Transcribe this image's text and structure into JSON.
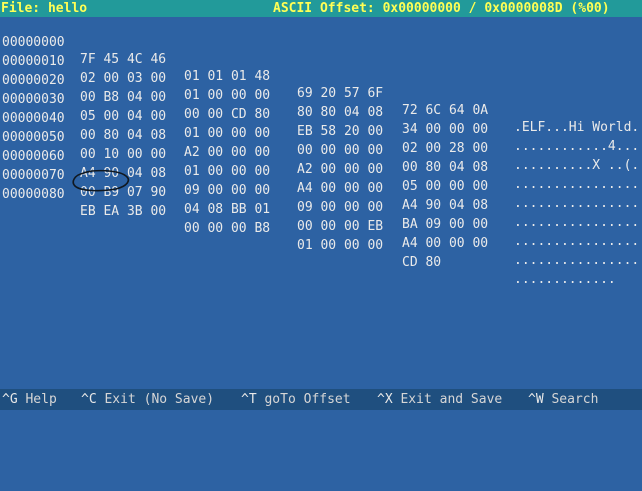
{
  "header": {
    "file_label": "File: hello",
    "offset_label": "ASCII Offset: 0x00000000 / 0x0000008D (%00)"
  },
  "rows": [
    {
      "addr": "00000000",
      "g1": "7F 45 4C 46",
      "g2": "01 01 01 48",
      "g3": "69 20 57 6F",
      "g4": "72 6C 64 0A",
      "ascii": ".ELF...Hi World."
    },
    {
      "addr": "00000010",
      "g1": "02 00 03 00",
      "g2": "01 00 00 00",
      "g3": "80 80 04 08",
      "g4": "34 00 00 00",
      "ascii": "............4..."
    },
    {
      "addr": "00000020",
      "g1": "00 B8 04 00",
      "g2": "00 00 CD 80",
      "g3": "EB 58 20 00",
      "g4": "02 00 28 00",
      "ascii": "..........X ..(."
    },
    {
      "addr": "00000030",
      "g1": "05 00 04 00",
      "g2": "01 00 00 00",
      "g3": "00 00 00 00",
      "g4": "00 80 04 08",
      "ascii": "................"
    },
    {
      "addr": "00000040",
      "g1": "00 80 04 08",
      "g2": "A2 00 00 00",
      "g3": "A2 00 00 00",
      "g4": "05 00 00 00",
      "ascii": "................"
    },
    {
      "addr": "00000050",
      "g1": "00 10 00 00",
      "g2": "01 00 00 00",
      "g3": "A4 00 00 00",
      "g4": "A4 90 04 08",
      "ascii": "................"
    },
    {
      "addr": "00000060",
      "g1": "A4 90 04 08",
      "g2": "09 00 00 00",
      "g3": "09 00 00 00",
      "g4": "BA 09 00 00",
      "ascii": "................"
    },
    {
      "addr": "00000070",
      "g1": "00 B9 07 90",
      "g2": "04 08 BB 01",
      "g3": "00 00 00 EB",
      "g4": "A4 00 00 00",
      "ascii": "................"
    },
    {
      "addr": "00000080",
      "g1": "EB EA 3B 00",
      "g2": "00 00 00 B8",
      "g3": "01 00 00 00",
      "g4": "CD 80",
      "ascii": "............."
    }
  ],
  "footer": {
    "commands": [
      {
        "key": "^G",
        "label": "Help"
      },
      {
        "key": "^C",
        "label": "Exit (No Save)"
      },
      {
        "key": "^T",
        "label": "goTo Offset"
      },
      {
        "key": "^X",
        "label": "Exit and Save"
      },
      {
        "key": "^W",
        "label": "Search"
      }
    ]
  },
  "colors": {
    "background": "#2d62a3",
    "titlebar_bg": "#229a9a",
    "titlebar_text": "#ffff54",
    "annotation_ink": "#101820"
  }
}
